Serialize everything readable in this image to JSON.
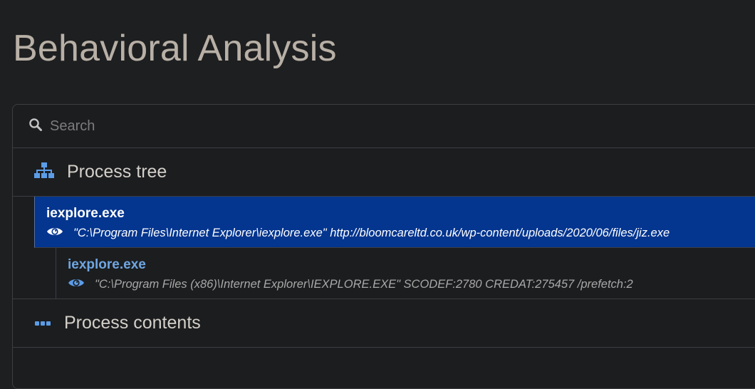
{
  "page": {
    "title": "Behavioral Analysis"
  },
  "search": {
    "placeholder": "Search",
    "icon": "search-icon"
  },
  "process_tree": {
    "label": "Process tree",
    "icon": "sitemap-icon",
    "processes": [
      {
        "name": "iexplore.exe",
        "command": "\"C:\\Program Files\\Internet Explorer\\iexplore.exe\" http://bloomcareltd.co.uk/wp-content/uploads/2020/06/files/jiz.exe",
        "selected": true
      },
      {
        "name": "iexplore.exe",
        "command": "\"C:\\Program Files (x86)\\Internet Explorer\\IEXPLORE.EXE\" SCODEF:2780 CREDAT:275457 /prefetch:2",
        "selected": false
      }
    ]
  },
  "process_contents": {
    "label": "Process contents",
    "icon": "ellipsis-icon"
  },
  "colors": {
    "background": "#1e1f21",
    "selected_row": "#04358f",
    "accent_blue": "#5b9ce6",
    "title": "#b8b0a6"
  }
}
